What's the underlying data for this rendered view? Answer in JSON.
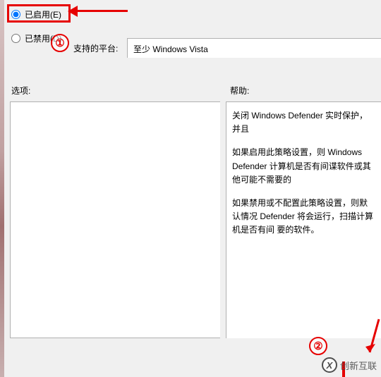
{
  "radios": {
    "enabled": {
      "label": "已启用(E)",
      "checked": true
    },
    "disabled": {
      "label": "已禁用(D)",
      "checked": false
    }
  },
  "supported": {
    "label": "支持的平台:",
    "value": "至少 Windows Vista"
  },
  "options": {
    "label": "选项:"
  },
  "help": {
    "label": "帮助:",
    "p1": "关闭 Windows Defender 实时保护，并且",
    "p2": "如果启用此策略设置，则 Windows Defender 计算机是否有间谍软件或其他可能不需要的",
    "p3": "如果禁用或不配置此策略设置，则默认情况 Defender 将会运行，扫描计算机是否有间 要的软件。"
  },
  "annotations": {
    "circle1": "①",
    "circle2": "②"
  },
  "watermark": {
    "logo": "X",
    "text": "创新互联"
  }
}
